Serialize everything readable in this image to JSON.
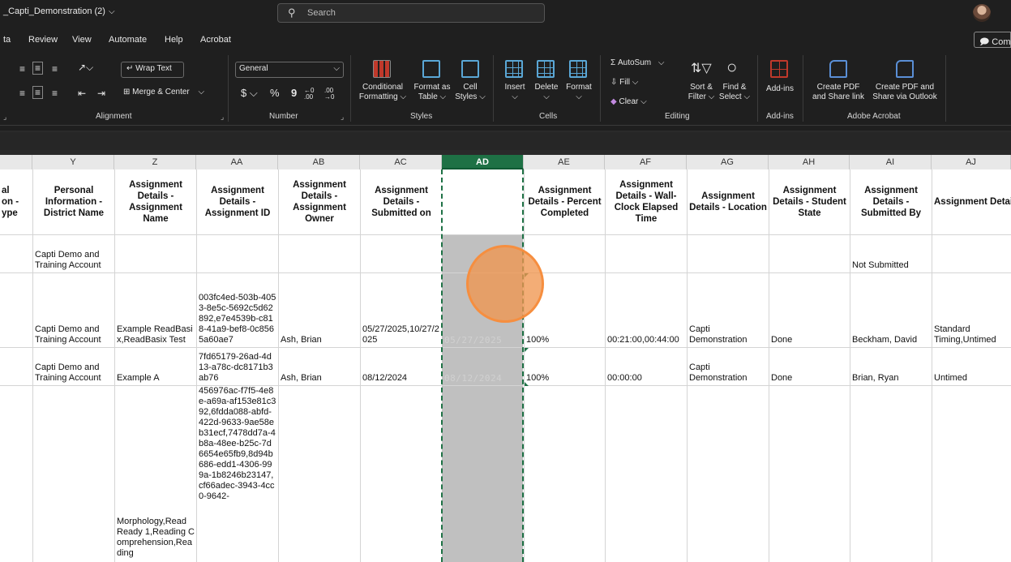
{
  "titlebar": {
    "doc_title": "_Capti_Demonstration (2)",
    "search_placeholder": "Search"
  },
  "menu": {
    "items": [
      "ta",
      "Review",
      "View",
      "Automate",
      "Help",
      "Acrobat"
    ],
    "comment_label": "Com"
  },
  "ribbon": {
    "wrap_text": "Wrap Text",
    "merge_center": "Merge & Center",
    "number_format": "General",
    "currency_symbol": "$",
    "percent_symbol": "%",
    "comma_symbol": "9",
    "inc_decimal": "←0 .00",
    "dec_decimal": ".00 →0",
    "conditional_formatting": [
      "Conditional",
      "Formatting"
    ],
    "format_as_table": [
      "Format as",
      "Table"
    ],
    "cell_styles": [
      "Cell",
      "Styles"
    ],
    "insert": "Insert",
    "delete": "Delete",
    "format": "Format",
    "autosum": "AutoSum",
    "fill": "Fill",
    "clear": "Clear",
    "sort_filter": [
      "Sort &",
      "Filter"
    ],
    "find_select": [
      "Find &",
      "Select"
    ],
    "add_ins": "Add-ins",
    "create_pdf_share": [
      "Create PDF",
      "and Share link"
    ],
    "create_pdf_outlook": [
      "Create PDF and",
      "Share via Outlook"
    ],
    "groups": {
      "alignment": "Alignment",
      "number": "Number",
      "styles": "Styles",
      "cells": "Cells",
      "editing": "Editing",
      "add_ins": "Add-ins",
      "adobe": "Adobe Acrobat"
    }
  },
  "columns": [
    "Y",
    "Z",
    "AA",
    "AB",
    "AC",
    "AD",
    "AE",
    "AF",
    "AG",
    "AH",
    "AI",
    "AJ"
  ],
  "header_row": {
    "x_partial": "al\non -\nype",
    "Y": "Personal Information - District Name",
    "Z": "Assignment Details - Assignment Name",
    "AA": "Assignment Details - Assignment ID",
    "AB": "Assignment Details - Assignment Owner",
    "AC": "Assignment Details - Submitted on",
    "AD": "",
    "AE": "Assignment Details - Percent Completed",
    "AF": "Assignment Details - Wall-Clock Elapsed Time",
    "AG": "Assignment Details - Location",
    "AH": "Assignment Details - Student State",
    "AI": "Assignment Details - Submitted By",
    "AJ": "Assignment Details - Time Accommodation"
  },
  "rows": [
    {
      "Y": "Capti Demo and Training Account",
      "AI": "Not Submitted"
    },
    {
      "Y": "Capti Demo and Training Account",
      "Z": "Example ReadBasix,ReadBasix Test",
      "AA": "003fc4ed-503b-4053-8e5c-5692c5d62892,e7e4539b-c818-41a9-bef8-0c8565a60ae7",
      "AB": "Ash, Brian",
      "AC": "05/27/2025,10/27/2025",
      "AD": "05/27/2025",
      "AE": "100%",
      "AF": "00:21:00,00:44:00",
      "AG": "Capti Demonstration",
      "AH": "Done",
      "AI": "Beckham, David",
      "AJ": "Standard Timing,Untimed"
    },
    {
      "Y": "Capti Demo and Training Account",
      "Z": "Example A",
      "AA": "7fd65179-26ad-4d13-a78c-dc8171b3ab76",
      "AB": "Ash, Brian",
      "AC": "08/12/2024",
      "AD": "08/12/2024",
      "AE": "100%",
      "AF": "00:00:00",
      "AG": "Capti Demonstration",
      "AH": "Done",
      "AI": "Brian, Ryan",
      "AJ": "Untimed"
    },
    {
      "Z": "Morphology,Read Ready 1,Reading Comprehension,Reading",
      "AA": "456976ac-f7f5-4e8e-a69a-af153e81c392,6fdda088-abfd-422d-9633-9ae58eb31ecf,7478dd7a-4b8a-48ee-b25c-7d6654e65fb9,8d94b686-edd1-4306-999a-1b8246b23147,cf66adec-3943-4cc0-9642-"
    }
  ]
}
